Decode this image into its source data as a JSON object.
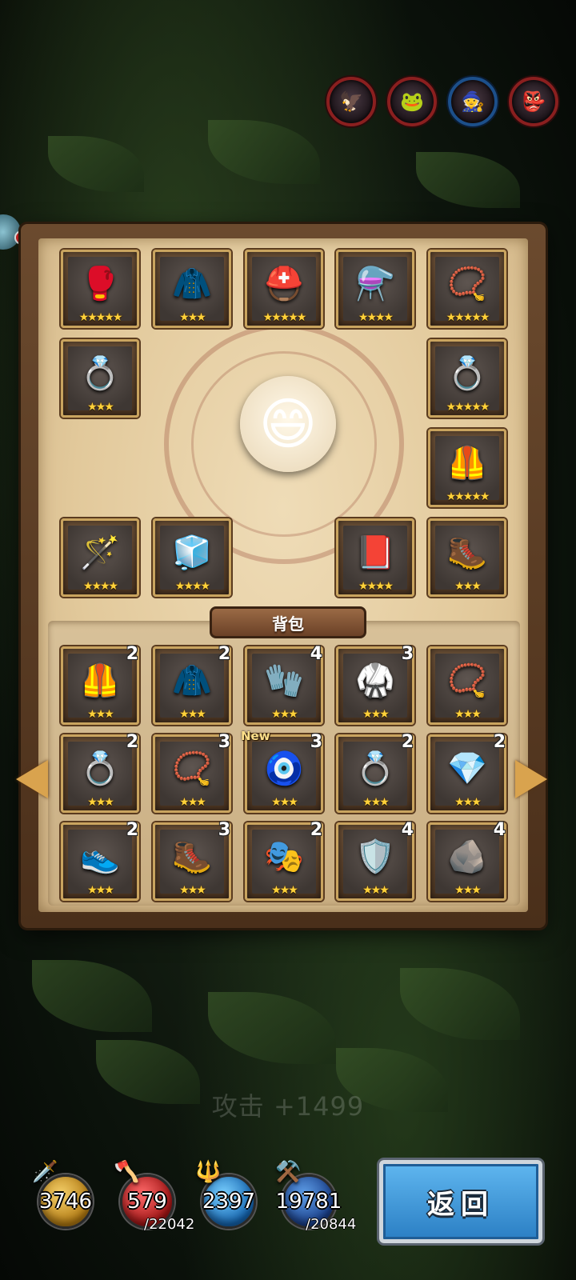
{
  "party": [
    {
      "icon": "🦅",
      "ring": "red"
    },
    {
      "icon": "🐸",
      "ring": "red"
    },
    {
      "icon": "🧙",
      "ring": "blue"
    },
    {
      "icon": "👺",
      "ring": "red"
    }
  ],
  "equipped": [
    {
      "icon": "🥊",
      "stars": "★★★★★"
    },
    {
      "icon": "🧥",
      "stars": "★★★"
    },
    {
      "icon": "⛑️",
      "stars": "★★★★★"
    },
    {
      "icon": "⚗️",
      "stars": "★★★★"
    },
    {
      "icon": "📿",
      "stars": "★★★★★"
    },
    {
      "icon": "💍",
      "stars": "★★★"
    },
    {
      "icon": "💍",
      "stars": "★★★★★"
    },
    {
      "icon": "🦺",
      "stars": "★★★★★"
    },
    {
      "icon": "🪄",
      "stars": "★★★★"
    },
    {
      "icon": "🧊",
      "stars": "★★★★"
    },
    {
      "icon": "📕",
      "stars": "★★★★"
    },
    {
      "icon": "🥾",
      "stars": "★★★"
    }
  ],
  "bag": {
    "title": "背包",
    "items": [
      {
        "icon": "🦺",
        "stars": "★★★",
        "count": "2",
        "tag": ""
      },
      {
        "icon": "🧥",
        "stars": "★★★",
        "count": "2",
        "tag": ""
      },
      {
        "icon": "🧤",
        "stars": "★★★",
        "count": "4",
        "tag": ""
      },
      {
        "icon": "🥋",
        "stars": "★★★",
        "count": "3",
        "tag": ""
      },
      {
        "icon": "📿",
        "stars": "★★★",
        "count": "",
        "tag": ""
      },
      {
        "icon": "💍",
        "stars": "★★★",
        "count": "2",
        "tag": ""
      },
      {
        "icon": "📿",
        "stars": "★★★",
        "count": "3",
        "tag": ""
      },
      {
        "icon": "🧿",
        "stars": "★★★",
        "count": "3",
        "tag": "New"
      },
      {
        "icon": "💍",
        "stars": "★★★",
        "count": "2",
        "tag": ""
      },
      {
        "icon": "💎",
        "stars": "★★★",
        "count": "2",
        "tag": ""
      },
      {
        "icon": "👟",
        "stars": "★★★",
        "count": "2",
        "tag": ""
      },
      {
        "icon": "🥾",
        "stars": "★★★",
        "count": "3",
        "tag": ""
      },
      {
        "icon": "🎭",
        "stars": "★★★",
        "count": "2",
        "tag": ""
      },
      {
        "icon": "🛡️",
        "stars": "★★★",
        "count": "4",
        "tag": ""
      },
      {
        "icon": "🪨",
        "stars": "★★★",
        "count": "4",
        "tag": ""
      }
    ]
  },
  "stat_hint": "攻击 +1499",
  "resources": [
    {
      "name": "attack",
      "icon": "🗡️",
      "value": "3746",
      "max": "",
      "orb": "gold"
    },
    {
      "name": "health",
      "icon": "🪓",
      "value": "579",
      "max": "/22042",
      "orb": "red"
    },
    {
      "name": "mana",
      "icon": "🔱",
      "value": "2397",
      "max": "",
      "orb": "blue"
    },
    {
      "name": "defense",
      "icon": "⚒️",
      "value": "19781",
      "max": "/20844",
      "orb": "navy"
    }
  ],
  "return_label": "返回",
  "hero_icon": "😄"
}
